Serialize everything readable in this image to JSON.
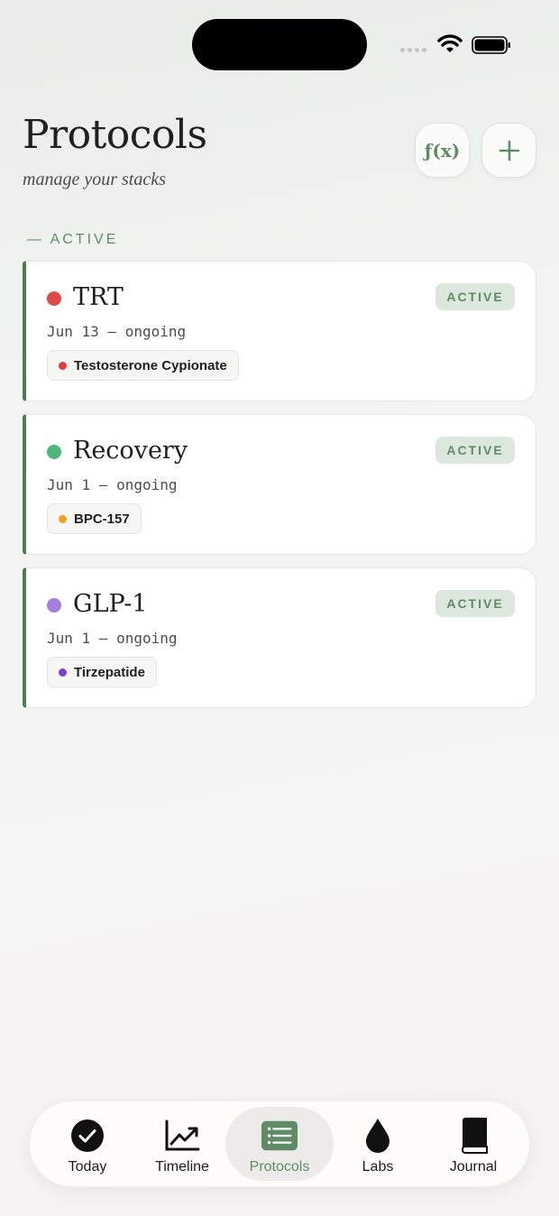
{
  "header": {
    "title": "Protocols",
    "subtitle": "manage your stacks",
    "fx_label": "ƒ(x)"
  },
  "section": {
    "label": "— ACTIVE"
  },
  "protocols": [
    {
      "name": "TRT",
      "dates": "Jun 13 — ongoing",
      "status": "ACTIVE",
      "color": "#e24a4a",
      "compounds": [
        {
          "name": "Testosterone Cypionate",
          "color": "#e03c3c"
        }
      ]
    },
    {
      "name": "Recovery",
      "dates": "Jun 1 — ongoing",
      "status": "ACTIVE",
      "color": "#4cb87a",
      "compounds": [
        {
          "name": "BPC-157",
          "color": "#f0a020"
        }
      ]
    },
    {
      "name": "GLP-1",
      "dates": "Jun 1 — ongoing",
      "status": "ACTIVE",
      "color": "#a67ee0",
      "compounds": [
        {
          "name": "Tirzepatide",
          "color": "#7a3fd6"
        }
      ]
    }
  ],
  "tabs": [
    {
      "label": "Today",
      "icon": "checkmark-circle-icon",
      "active": false
    },
    {
      "label": "Timeline",
      "icon": "trend-chart-icon",
      "active": false
    },
    {
      "label": "Protocols",
      "icon": "list-icon",
      "active": true
    },
    {
      "label": "Labs",
      "icon": "drop-icon",
      "active": false
    },
    {
      "label": "Journal",
      "icon": "book-icon",
      "active": false
    }
  ],
  "colors": {
    "accent": "#5f8c67",
    "accent_bar": "#4f7b55",
    "badge_bg": "#dce7de"
  }
}
